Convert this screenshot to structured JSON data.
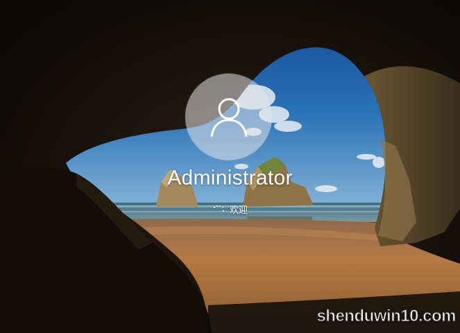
{
  "user": {
    "name": "Administrator",
    "avatar_icon": "user-icon"
  },
  "status": {
    "spinner_icon": "loading-dots-icon",
    "message": "欢迎"
  },
  "watermark": {
    "text": "shenduwin10.com"
  },
  "colors": {
    "sky_top": "#0f4f9a",
    "sky_bottom": "#6fa4cf",
    "sand": "#b07845",
    "cave_rock": "#1a130c"
  }
}
